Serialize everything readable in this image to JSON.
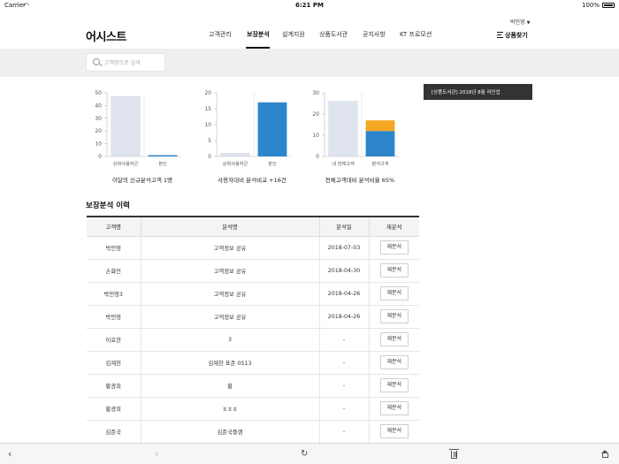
{
  "status_bar": {
    "carrier": "Carrier",
    "time": "6:21 PM",
    "battery": "100%"
  },
  "header": {
    "logo": "어시스트",
    "user": "박민영",
    "nav": [
      "고객관리",
      "보장분석",
      "설계지원",
      "상품도서관",
      "공지사항",
      "KT 프로모션"
    ],
    "active_nav": "보장분석",
    "product_search": "상품찾기"
  },
  "search": {
    "placeholder": "고객명으로 검색",
    "value": ""
  },
  "chart_data": [
    {
      "type": "bar",
      "categories": [
        "상위사용자군",
        "본인"
      ],
      "values": [
        47,
        1
      ],
      "ylim": [
        0,
        50
      ],
      "yticks": [
        0,
        10,
        20,
        30,
        40,
        50
      ],
      "bar_colors": [
        "#dfe4ef",
        "#2d86cc"
      ],
      "grid": false,
      "caption": "이달의 신규분석고객 1명"
    },
    {
      "type": "bar",
      "categories": [
        "상위사용자군",
        "본인"
      ],
      "values": [
        1,
        17
      ],
      "ylim": [
        0,
        20
      ],
      "yticks": [
        0,
        5,
        10,
        15,
        20
      ],
      "bar_colors": [
        "#dfe4ef",
        "#2d86cc"
      ],
      "grid": false,
      "caption": "사용자대비 분석비교 +16건"
    },
    {
      "type": "bar",
      "stacked": true,
      "categories": [
        "내 전체고객",
        "분석고객"
      ],
      "series": [
        {
          "values": [
            26,
            12
          ],
          "colors": [
            "#dfe4ef",
            "#2d86cc"
          ]
        },
        {
          "values": [
            0,
            5
          ],
          "colors": [
            "#dfe4ef",
            "#f5a623"
          ]
        }
      ],
      "ylim": [
        0,
        30
      ],
      "yticks": [
        0,
        10,
        20,
        30
      ],
      "grid": false,
      "caption": "전체고객대비 분석비율 65%"
    }
  ],
  "notice": "[상품도서관] 2018년 8월 라인업",
  "history": {
    "title": "보장분석 이력",
    "columns": [
      "고객명",
      "분석명",
      "분석일",
      "재분석"
    ],
    "rows": [
      {
        "customer": "박민영",
        "name": "고객정보 공유",
        "date": "2018-07-03",
        "action": "재분석"
      },
      {
        "customer": "손화민",
        "name": "고객정보 공유",
        "date": "2018-04-30",
        "action": "재분석"
      },
      {
        "customer": "박민영3",
        "name": "고객정보 공유",
        "date": "2018-04-26",
        "action": "재분석"
      },
      {
        "customer": "박민영",
        "name": "고객정보 공유",
        "date": "2018-04-26",
        "action": "재분석"
      },
      {
        "customer": "이효한",
        "name": "3",
        "date": "-",
        "action": "재분석"
      },
      {
        "customer": "김재현",
        "name": "김재현 표준 0513",
        "date": "-",
        "action": "재분석"
      },
      {
        "customer": "황광희",
        "name": "황",
        "date": "-",
        "action": "재분석"
      },
      {
        "customer": "황광희",
        "name": "ㅎㅎㅎ",
        "date": "-",
        "action": "재분석"
      },
      {
        "customer": "김준국",
        "name": "김준국플랜",
        "date": "-",
        "action": "재분석"
      }
    ]
  },
  "toolbar": {
    "back": "‹",
    "forward": "›",
    "reload": "↻"
  }
}
